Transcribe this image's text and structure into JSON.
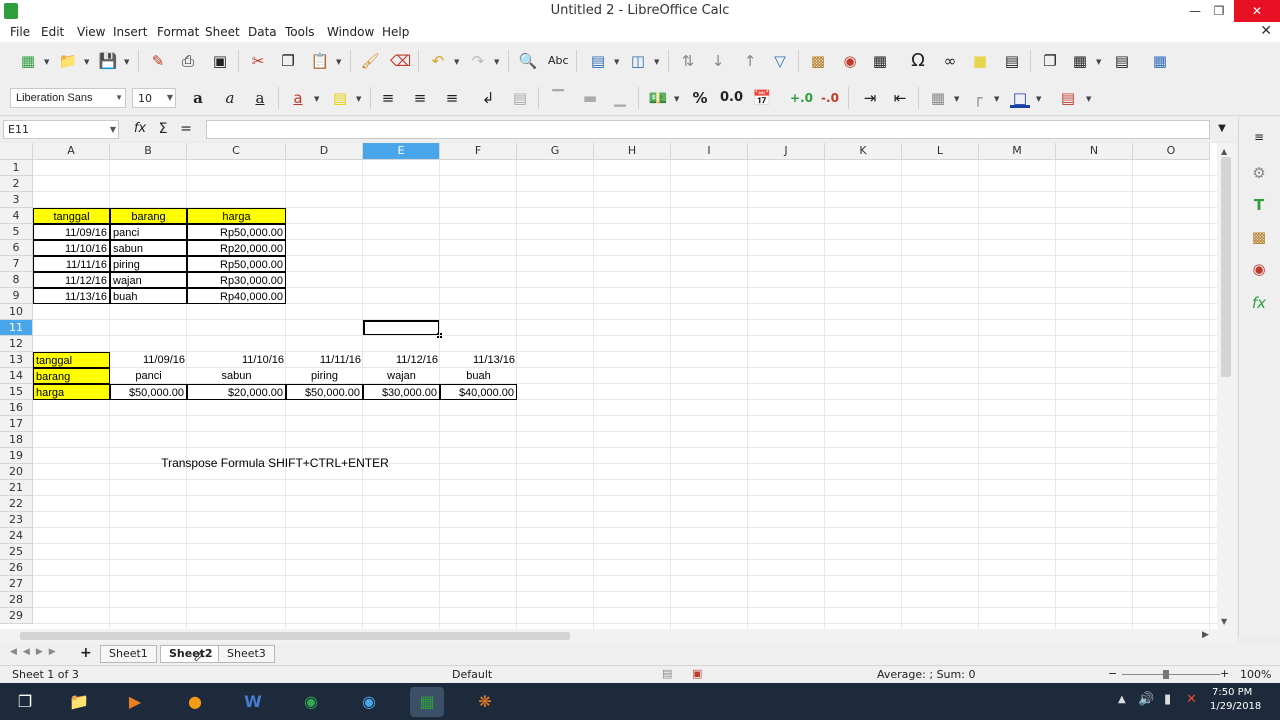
{
  "window": {
    "title": "Untitled 2 - LibreOffice Calc"
  },
  "menu": [
    "File",
    "Edit",
    "View",
    "Insert",
    "Format",
    "Sheet",
    "Data",
    "Tools",
    "Window",
    "Help"
  ],
  "format": {
    "font_name": "Liberation Sans",
    "font_size": "10"
  },
  "formula_bar": {
    "cell_ref": "E11",
    "input": ""
  },
  "columns": [
    "A",
    "B",
    "C",
    "D",
    "E",
    "F",
    "G",
    "H",
    "I",
    "J",
    "K",
    "L",
    "M",
    "N",
    "O"
  ],
  "rows": [
    "1",
    "2",
    "3",
    "4",
    "5",
    "6",
    "7",
    "8",
    "9",
    "10",
    "11",
    "12",
    "13",
    "14",
    "15",
    "16",
    "17",
    "18",
    "19",
    "20",
    "21",
    "22",
    "23",
    "24",
    "25",
    "26",
    "27",
    "28",
    "29"
  ],
  "table1": {
    "headers": [
      "tanggal",
      "barang",
      "harga"
    ],
    "rows": [
      [
        "11/09/16",
        "panci",
        "Rp50,000.00"
      ],
      [
        "11/10/16",
        "sabun",
        "Rp20,000.00"
      ],
      [
        "11/11/16",
        "piring",
        "Rp50,000.00"
      ],
      [
        "11/12/16",
        "wajan",
        "Rp30,000.00"
      ],
      [
        "11/13/16",
        "buah",
        "Rp40,000.00"
      ]
    ]
  },
  "table2": {
    "labels": [
      "tanggal",
      "barang",
      "harga"
    ],
    "tanggal": [
      "11/09/16",
      "11/10/16",
      "11/11/16",
      "11/12/16",
      "11/13/16"
    ],
    "barang": [
      "panci",
      "sabun",
      "piring",
      "wajan",
      "buah"
    ],
    "harga": [
      "$50,000.00",
      "$20,000.00",
      "$50,000.00",
      "$30,000.00",
      "$40,000.00"
    ]
  },
  "note": "Transpose Formula SHIFT+CTRL+ENTER",
  "sheets": [
    "Sheet1",
    "Sheet2",
    "Sheet3"
  ],
  "status": {
    "sheet_info": "Sheet 1 of 3",
    "page_style": "Default",
    "summary": "Average: ; Sum: 0",
    "zoom": "100%"
  },
  "clock": {
    "time": "7:50 PM",
    "date": "1/29/2018"
  },
  "colors": {
    "highlight": "#ffff00",
    "selected_header": "#4aa6ea"
  }
}
